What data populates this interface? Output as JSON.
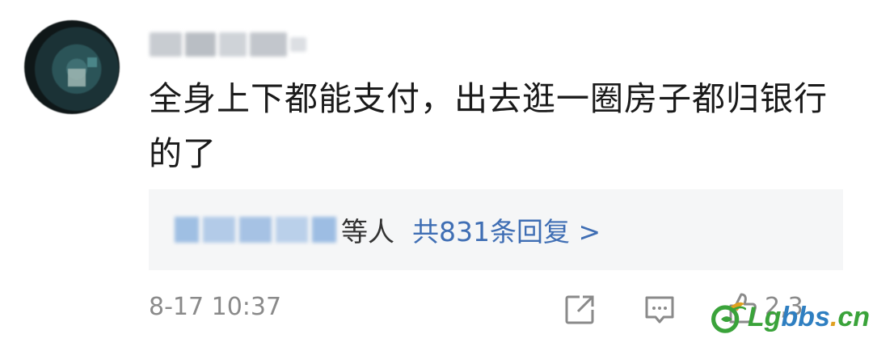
{
  "comment": {
    "username": "",
    "text": "全身上下都能支付，出去逛一圈房子都归银行的了",
    "replies": {
      "suffix": "等人",
      "count_text": "共831条回复 >"
    },
    "time": "8-17 10:37",
    "like_count": "2,3"
  },
  "icons": {
    "avatar": "avatar-image",
    "share": "share-icon",
    "comment": "comment-icon",
    "like": "like-icon"
  },
  "watermark": {
    "prefix": "Lg",
    "mid": "bbs",
    "dot": ".",
    "suffix": "cn"
  },
  "colors": {
    "link": "#3f6eb4",
    "reply_bg": "#f5f6f7",
    "meta_text": "#8a8a8a",
    "watermark_green": "#3aa33a"
  }
}
